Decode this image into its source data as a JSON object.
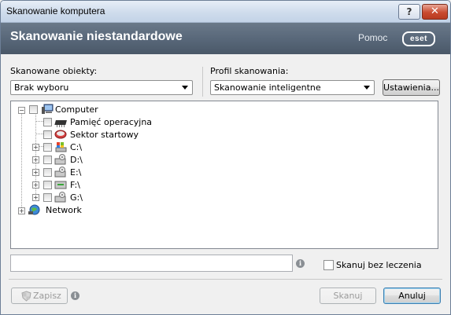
{
  "window": {
    "title": "Skanowanie komputera",
    "help_button": "?",
    "close_button": "✕"
  },
  "header": {
    "title": "Skanowanie niestandardowe",
    "help_link": "Pomoc",
    "logo_text": "eset"
  },
  "targets": {
    "label": "Skanowane obiekty:",
    "selected": "Brak wyboru"
  },
  "profile": {
    "label": "Profil skanowania:",
    "selected": "Skanowanie inteligentne",
    "settings_button": "Ustawienia..."
  },
  "tree": {
    "computer": "Computer",
    "memory": "Pamięć operacyjna",
    "boot": "Sektor startowy",
    "drives": [
      "C:\\",
      "D:\\",
      "E:\\",
      "F:\\",
      "G:\\"
    ],
    "network": "Network"
  },
  "path_input": {
    "value": ""
  },
  "options": {
    "scan_without_cleaning": "Skanuj bez leczenia",
    "scan_without_cleaning_checked": false
  },
  "footer": {
    "save_button": "Zapisz",
    "scan_button": "Skanuj",
    "cancel_button": "Anuluj"
  },
  "colors": {
    "header_bg": "#59687a",
    "close_btn": "#c94a2f"
  }
}
